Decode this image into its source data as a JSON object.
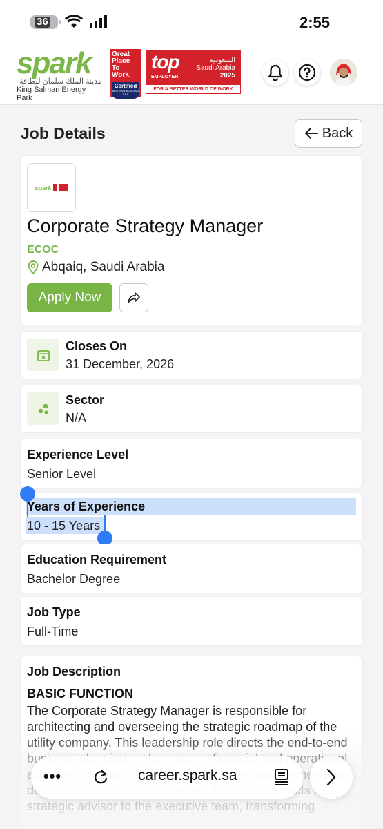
{
  "status_bar": {
    "battery": "36",
    "time": "2:55"
  },
  "header": {
    "logo_word": "spark",
    "logo_arabic": "مدينة الملك سلمان للطاقة",
    "logo_english": "King Salman Energy Park",
    "gptw_lines": [
      "Great",
      "Place",
      "To",
      "Work."
    ],
    "gptw_certified": "Certified",
    "gptw_dates": "NOV 2023-NOV 2024 KSA",
    "top_employer_big": "top",
    "top_employer_label": "EMPLOYER",
    "top_employer_arabic": "السعودية",
    "top_employer_country": "Saudi Arabia",
    "top_employer_year": "2025",
    "top_employer_footer": "FOR A BETTER WORLD OF WORK",
    "icons": [
      "bell-icon",
      "help-icon",
      "user-avatar"
    ]
  },
  "page": {
    "title": "Job Details",
    "back_label": "Back"
  },
  "job": {
    "title": "Corporate Strategy Manager",
    "company": "ECOC",
    "location": "Abqaiq, Saudi Arabia",
    "apply_label": "Apply Now"
  },
  "closes": {
    "label": "Closes On",
    "value": "31 December, 2026"
  },
  "sector": {
    "label": "Sector",
    "value": "N/A"
  },
  "experience_level": {
    "label": "Experience Level",
    "value": "Senior Level"
  },
  "years_experience": {
    "label": "Years of Experience",
    "value": "10 - 15 Years"
  },
  "education": {
    "label": "Education Requirement",
    "value": "Bachelor Degree"
  },
  "job_type": {
    "label": "Job Type",
    "value": "Full-Time"
  },
  "description": {
    "heading": "Job Description",
    "sub_heading": "BASIC FUNCTION",
    "body": "The Corporate Strategy Manager is responsible for architecting and overseeing the strategic roadmap of the utility company. This leadership role directs the end-to-end business planning cycle, ensures financial and operational alignment through rigorous performance management, and develops optimization strategies. The Manager acts as a strategic advisor to the executive team, transforming"
  },
  "browser": {
    "url": "career.spark.sa",
    "menu_dots": "•••"
  },
  "colors": {
    "brand_green": "#78b544",
    "selection": "#cde0fb",
    "handle": "#2f7cf6"
  }
}
